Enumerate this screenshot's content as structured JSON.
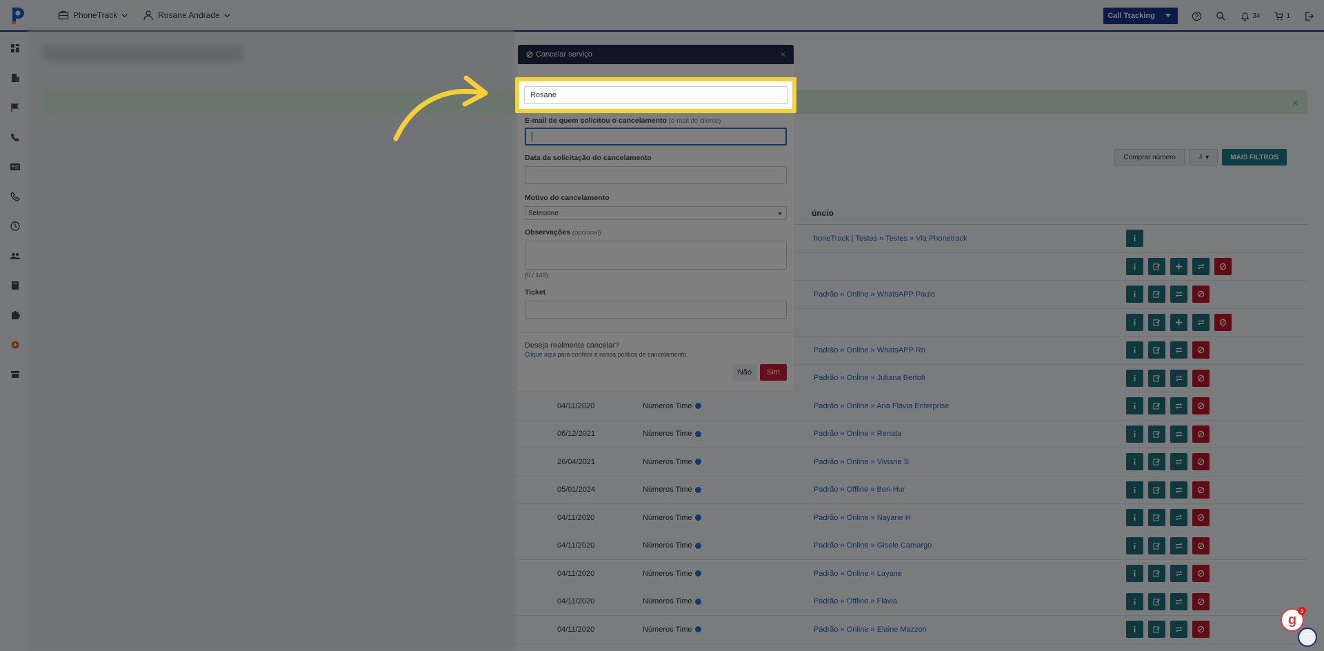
{
  "topbar": {
    "workspace": "PhoneTrack",
    "user": "Rosane Andrade",
    "product_select": "Call Tracking",
    "notifications_count": "34",
    "cart_count": "1"
  },
  "toolbar": {
    "buy_number": "Comprar número",
    "export": "⇩ ▾",
    "more_filters": "MAIS FILTROS"
  },
  "table": {
    "col_announcement": "úncio",
    "rows": [
      {
        "date": "",
        "plan": "",
        "link": "honeTrack | Testes » Testes » Via Phonetrack",
        "actions": [
          "info"
        ]
      },
      {
        "date": "",
        "plan": "",
        "link": "",
        "actions": [
          "info",
          "edit",
          "plus",
          "swap",
          "cancel"
        ]
      },
      {
        "date": "",
        "plan": "",
        "link": "Padrão » Online » WhatsAPP Paulo",
        "actions": [
          "info",
          "edit",
          "swap",
          "cancel"
        ]
      },
      {
        "date": "",
        "plan": "",
        "link": "",
        "actions": [
          "info",
          "edit",
          "plus",
          "swap",
          "cancel"
        ]
      },
      {
        "date": "",
        "plan": "",
        "link": "Padrão » Online » WhatsAPP Ro",
        "actions": [
          "info",
          "edit",
          "swap",
          "cancel"
        ]
      },
      {
        "date": "",
        "plan": "",
        "link": "Padrão » Online » Juliana Bertoti",
        "actions": [
          "info",
          "edit",
          "swap",
          "cancel"
        ]
      },
      {
        "date": "04/11/2020",
        "plan": "Números Time",
        "link": "Padrão » Online » Ana Flávia Enterprise",
        "actions": [
          "info",
          "edit",
          "swap",
          "cancel"
        ]
      },
      {
        "date": "06/12/2021",
        "plan": "Números Time",
        "link": "Padrão » Online » Renata",
        "actions": [
          "info",
          "edit",
          "swap",
          "cancel"
        ]
      },
      {
        "date": "26/04/2021",
        "plan": "Números Time",
        "link": "Padrão » Online » Viviane S",
        "actions": [
          "info",
          "edit",
          "swap",
          "cancel"
        ]
      },
      {
        "date": "05/01/2024",
        "plan": "Números Time",
        "link": "Padrão » Offline » Ben-Hur",
        "actions": [
          "info",
          "edit",
          "swap",
          "cancel"
        ]
      },
      {
        "date": "04/11/2020",
        "plan": "Números Time",
        "link": "Padrão » Online » Nayane H",
        "actions": [
          "info",
          "edit",
          "swap",
          "cancel"
        ]
      },
      {
        "date": "04/11/2020",
        "plan": "Números Time",
        "link": "Padrão » Online » Gisele Camargo",
        "actions": [
          "info",
          "edit",
          "swap",
          "cancel"
        ]
      },
      {
        "date": "04/11/2020",
        "plan": "Números Time",
        "link": "Padrão » Online » Layane",
        "actions": [
          "info",
          "edit",
          "swap",
          "cancel"
        ]
      },
      {
        "date": "04/11/2020",
        "plan": "Números Time",
        "link": "Padrão » Offline » Flávia",
        "actions": [
          "info",
          "edit",
          "swap",
          "cancel"
        ]
      },
      {
        "date": "04/11/2020",
        "plan": "Números Time",
        "link": "Padrão » Online » Elaine Mazzon",
        "actions": [
          "info",
          "edit",
          "swap",
          "cancel"
        ]
      }
    ]
  },
  "modal": {
    "title": "Cancelar serviço",
    "name_value": "Rosane",
    "email_label": "E-mail de quem solicitou o cancelamento",
    "email_hint": "(e-mail do cliente)",
    "date_label": "Data da solicitação do cancelamento",
    "reason_label": "Motivo do cancelamento",
    "reason_selected": "Selecione",
    "notes_label": "Observações",
    "notes_hint": "(opcional)",
    "notes_counter": "(0 / 140)",
    "ticket_label": "Ticket",
    "confirm_question": "Deseja realmente cancelar?",
    "policy_link": "Clique aqui",
    "policy_text": "para conferir a nossa política de cancelamento.",
    "btn_no": "Não",
    "btn_yes": "Sim"
  },
  "colors": {
    "navy": "#1a2f6e",
    "teal": "#1c6f7c",
    "danger": "#c0162c",
    "highlight": "#f5d33c"
  },
  "widget": {
    "badge": "1",
    "letter": "g"
  }
}
